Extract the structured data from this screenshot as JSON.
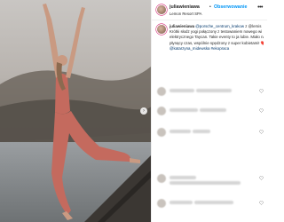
{
  "post": {
    "username": "juliawieniawa",
    "separator": "•",
    "follow_label": "Obserwowanie",
    "location": "Lemon Resort SPA",
    "caption": {
      "username": "juliawieniawa",
      "mention": "@porsche_centrum_krakow",
      "text_1": "z @lemis",
      "line_2": "Krótki słodz yogi połączony z testowaniem nowego wi",
      "line_3": "elektrycznego Taycan. Takie eventy to ja lubie. Miało na",
      "line_4": "płynący czas, wspólnie spędzony z super kobietami! ❤️ @",
      "line_5": "@katarzyna_midewska #ekopraca"
    }
  },
  "colors": {
    "link": "#0095f6",
    "mention": "#00376b",
    "text": "#262626"
  },
  "icons": [
    "more-options-icon",
    "heart-icon",
    "carousel-arrow-icon"
  ]
}
